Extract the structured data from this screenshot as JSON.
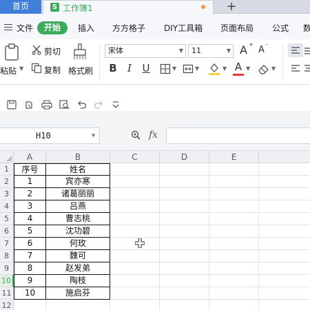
{
  "tabs": {
    "home_label": "首页",
    "doc_icon_letter": "S",
    "doc_title": "工作簿1",
    "new_tab_label": "+"
  },
  "menu": {
    "file": "文件",
    "items": [
      "开始",
      "插入",
      "方方格子",
      "DIY工具箱",
      "页面布局",
      "公式",
      "数"
    ]
  },
  "ribbon": {
    "paste": "粘贴",
    "cut": "剪切",
    "copy": "复制",
    "format_painter": "格式刷",
    "font_name": "宋体",
    "font_size": "11",
    "grow_font": "A",
    "shrink_font": "A",
    "bold": "B",
    "italic": "I",
    "underline": "U",
    "font_color_glyph": "A",
    "accent_color": "#3cab5b",
    "font_color_bar": "#e53935",
    "fill_color_bar": "#f5d03b"
  },
  "formula_bar": {
    "cell_ref": "H10",
    "fx": "fx",
    "formula": ""
  },
  "sheet": {
    "columns": [
      "A",
      "B",
      "C",
      "D",
      "E"
    ],
    "rows": [
      "1",
      "2",
      "3",
      "4",
      "5",
      "6",
      "7",
      "8",
      "9",
      "10",
      "11",
      "12"
    ],
    "selected_row": "10",
    "data": [
      [
        "序号",
        "姓名"
      ],
      [
        "1",
        "宾亦寒"
      ],
      [
        "2",
        "诸葛丽丽"
      ],
      [
        "3",
        "吕燕"
      ],
      [
        "4",
        "曹志桃"
      ],
      [
        "5",
        "沈功碧"
      ],
      [
        "6",
        "何玫"
      ],
      [
        "7",
        "魏可"
      ],
      [
        "8",
        "赵发弟"
      ],
      [
        "9",
        "陶枝"
      ],
      [
        "10",
        "施启芬"
      ]
    ]
  }
}
